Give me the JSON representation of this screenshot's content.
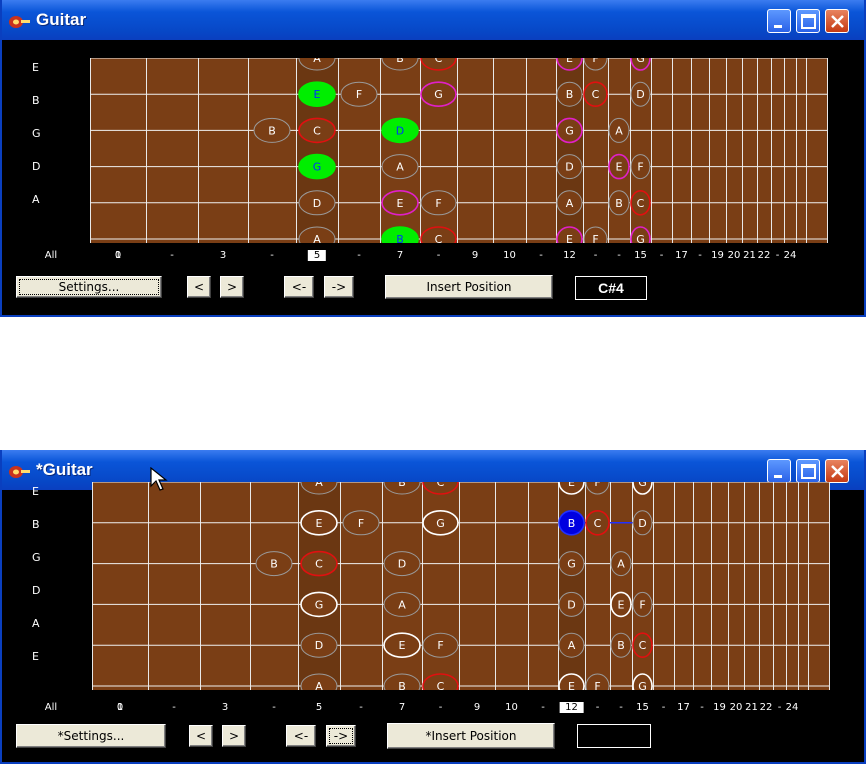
{
  "colors": {
    "board": "#7a3e15",
    "selected_note_fill": "#00ee00",
    "current_note_fill": "#0000e0"
  },
  "strings": [
    "E",
    "B",
    "G",
    "D",
    "A",
    "E"
  ],
  "fret_numbers": [
    {
      "fret": "0",
      "label": "0"
    },
    {
      "fret": "1",
      "label": "1"
    },
    {
      "fret": "2",
      "label": "-"
    },
    {
      "fret": "3",
      "label": "3"
    },
    {
      "fret": "4",
      "label": "-"
    },
    {
      "fret": "5",
      "label": "5"
    },
    {
      "fret": "6",
      "label": "-"
    },
    {
      "fret": "7",
      "label": "7"
    },
    {
      "fret": "8",
      "label": "-"
    },
    {
      "fret": "9",
      "label": "9"
    },
    {
      "fret": "10",
      "label": "10"
    },
    {
      "fret": "11",
      "label": "-"
    },
    {
      "fret": "12",
      "label": "12"
    },
    {
      "fret": "13",
      "label": "-"
    },
    {
      "fret": "14",
      "label": "-"
    },
    {
      "fret": "15",
      "label": "15"
    },
    {
      "fret": "16",
      "label": "-"
    },
    {
      "fret": "17",
      "label": "17"
    },
    {
      "fret": "18",
      "label": "-"
    },
    {
      "fret": "19",
      "label": "19"
    },
    {
      "fret": "20",
      "label": "20"
    },
    {
      "fret": "21",
      "label": "21"
    },
    {
      "fret": "22",
      "label": "22"
    },
    {
      "fret": "23",
      "label": "-"
    },
    {
      "fret": "24",
      "label": "24"
    }
  ],
  "windows": [
    {
      "title": "Guitar",
      "all_label": "All",
      "selected_fret": "5",
      "settings_label": "Settings...",
      "prev_label": "<",
      "next_label": ">",
      "pos_prev_label": "<-",
      "pos_next_label": "->",
      "insert_label": "Insert Position",
      "current_note": "C#4",
      "highlight_fret_a": "5",
      "highlight_fret_b": "12",
      "notes": [
        {
          "s": 0,
          "f": "5",
          "n": "A",
          "ring": "gray"
        },
        {
          "s": 0,
          "f": "7",
          "n": "B",
          "ring": "gray"
        },
        {
          "s": 0,
          "f": "8",
          "n": "C",
          "ring": "red"
        },
        {
          "s": 0,
          "f": "12",
          "n": "E",
          "ring": "magenta"
        },
        {
          "s": 0,
          "f": "13",
          "n": "F",
          "ring": "gray"
        },
        {
          "s": 0,
          "f": "15",
          "n": "G",
          "ring": "magenta"
        },
        {
          "s": 1,
          "f": "5",
          "n": "E",
          "ring": "green",
          "fill": "green"
        },
        {
          "s": 1,
          "f": "6",
          "n": "F",
          "ring": "gray"
        },
        {
          "s": 1,
          "f": "8",
          "n": "G",
          "ring": "magenta"
        },
        {
          "s": 1,
          "f": "12",
          "n": "B",
          "ring": "gray"
        },
        {
          "s": 1,
          "f": "13",
          "n": "C",
          "ring": "red"
        },
        {
          "s": 1,
          "f": "15",
          "n": "D",
          "ring": "gray"
        },
        {
          "s": 2,
          "f": "4",
          "n": "B",
          "ring": "gray"
        },
        {
          "s": 2,
          "f": "5",
          "n": "C",
          "ring": "red"
        },
        {
          "s": 2,
          "f": "7",
          "n": "D",
          "ring": "green",
          "fill": "green"
        },
        {
          "s": 2,
          "f": "12",
          "n": "G",
          "ring": "magenta"
        },
        {
          "s": 2,
          "f": "14",
          "n": "A",
          "ring": "gray"
        },
        {
          "s": 3,
          "f": "5",
          "n": "G",
          "ring": "green",
          "fill": "green"
        },
        {
          "s": 3,
          "f": "7",
          "n": "A",
          "ring": "gray"
        },
        {
          "s": 3,
          "f": "12",
          "n": "D",
          "ring": "gray"
        },
        {
          "s": 3,
          "f": "14",
          "n": "E",
          "ring": "magenta"
        },
        {
          "s": 3,
          "f": "15",
          "n": "F",
          "ring": "gray"
        },
        {
          "s": 4,
          "f": "5",
          "n": "D",
          "ring": "gray"
        },
        {
          "s": 4,
          "f": "7",
          "n": "E",
          "ring": "magenta"
        },
        {
          "s": 4,
          "f": "8",
          "n": "F",
          "ring": "gray"
        },
        {
          "s": 4,
          "f": "12",
          "n": "A",
          "ring": "gray"
        },
        {
          "s": 4,
          "f": "14",
          "n": "B",
          "ring": "gray"
        },
        {
          "s": 4,
          "f": "15",
          "n": "C",
          "ring": "red"
        },
        {
          "s": 5,
          "f": "5",
          "n": "A",
          "ring": "gray"
        },
        {
          "s": 5,
          "f": "7",
          "n": "B",
          "ring": "green",
          "fill": "green"
        },
        {
          "s": 5,
          "f": "8",
          "n": "C",
          "ring": "red"
        },
        {
          "s": 5,
          "f": "12",
          "n": "E",
          "ring": "magenta"
        },
        {
          "s": 5,
          "f": "13",
          "n": "F",
          "ring": "gray"
        },
        {
          "s": 5,
          "f": "15",
          "n": "G",
          "ring": "magenta"
        }
      ]
    },
    {
      "title": "*Guitar",
      "all_label": "All",
      "selected_fret": "12",
      "settings_label": "*Settings...",
      "prev_label": "<",
      "next_label": ">",
      "pos_prev_label": "<-",
      "pos_next_label": "->",
      "insert_label": "*Insert Position",
      "current_note": "",
      "highlight_fret_a": "5",
      "highlight_fret_b": "12",
      "notes": [
        {
          "s": 0,
          "f": "5",
          "n": "A",
          "ring": "gray"
        },
        {
          "s": 0,
          "f": "7",
          "n": "B",
          "ring": "gray"
        },
        {
          "s": 0,
          "f": "8",
          "n": "C",
          "ring": "red"
        },
        {
          "s": 0,
          "f": "12",
          "n": "E",
          "ring": "white"
        },
        {
          "s": 0,
          "f": "13",
          "n": "F",
          "ring": "gray"
        },
        {
          "s": 0,
          "f": "15",
          "n": "G",
          "ring": "white"
        },
        {
          "s": 1,
          "f": "5",
          "n": "E",
          "ring": "white"
        },
        {
          "s": 1,
          "f": "6",
          "n": "F",
          "ring": "gray"
        },
        {
          "s": 1,
          "f": "8",
          "n": "G",
          "ring": "white"
        },
        {
          "s": 1,
          "f": "12",
          "n": "B",
          "ring": "blue",
          "fill": "blue"
        },
        {
          "s": 1,
          "f": "13",
          "n": "C",
          "ring": "red"
        },
        {
          "s": 1,
          "f": "15",
          "n": "D",
          "ring": "gray"
        },
        {
          "s": 2,
          "f": "4",
          "n": "B",
          "ring": "gray"
        },
        {
          "s": 2,
          "f": "5",
          "n": "C",
          "ring": "red"
        },
        {
          "s": 2,
          "f": "7",
          "n": "D",
          "ring": "gray"
        },
        {
          "s": 2,
          "f": "12",
          "n": "G",
          "ring": "gray"
        },
        {
          "s": 2,
          "f": "14",
          "n": "A",
          "ring": "gray"
        },
        {
          "s": 3,
          "f": "5",
          "n": "G",
          "ring": "white"
        },
        {
          "s": 3,
          "f": "7",
          "n": "A",
          "ring": "gray"
        },
        {
          "s": 3,
          "f": "12",
          "n": "D",
          "ring": "gray"
        },
        {
          "s": 3,
          "f": "14",
          "n": "E",
          "ring": "white"
        },
        {
          "s": 3,
          "f": "15",
          "n": "F",
          "ring": "gray"
        },
        {
          "s": 4,
          "f": "5",
          "n": "D",
          "ring": "gray"
        },
        {
          "s": 4,
          "f": "7",
          "n": "E",
          "ring": "white"
        },
        {
          "s": 4,
          "f": "8",
          "n": "F",
          "ring": "gray"
        },
        {
          "s": 4,
          "f": "12",
          "n": "A",
          "ring": "gray"
        },
        {
          "s": 4,
          "f": "14",
          "n": "B",
          "ring": "gray"
        },
        {
          "s": 4,
          "f": "15",
          "n": "C",
          "ring": "red"
        },
        {
          "s": 5,
          "f": "5",
          "n": "A",
          "ring": "gray"
        },
        {
          "s": 5,
          "f": "7",
          "n": "B",
          "ring": "gray"
        },
        {
          "s": 5,
          "f": "8",
          "n": "C",
          "ring": "red"
        },
        {
          "s": 5,
          "f": "12",
          "n": "E",
          "ring": "white"
        },
        {
          "s": 5,
          "f": "13",
          "n": "F",
          "ring": "gray"
        },
        {
          "s": 5,
          "f": "15",
          "n": "G",
          "ring": "white"
        }
      ]
    }
  ]
}
